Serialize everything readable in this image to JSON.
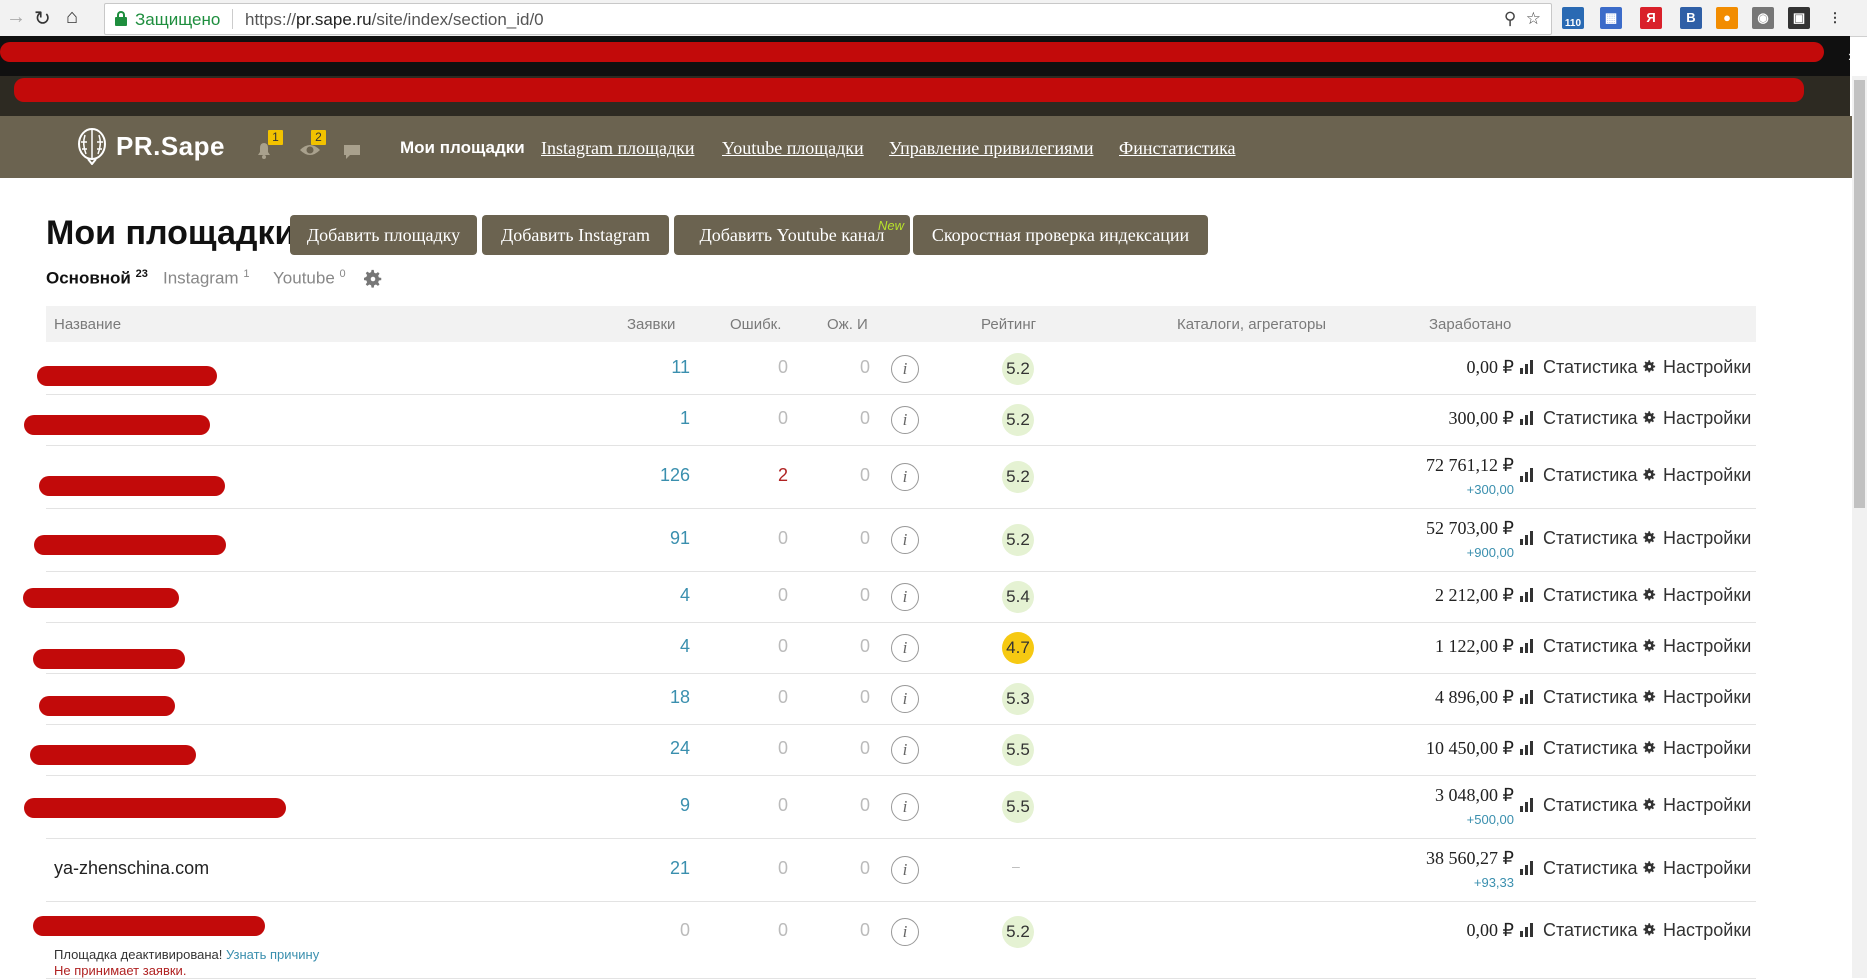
{
  "browser": {
    "secure_label": "Защищено",
    "url_prefix": "https://",
    "url_host": "pr.sape.ru",
    "url_path": "/site/index/section_id/0",
    "extension_badge": "110"
  },
  "header": {
    "logo_text": "PR.Sape",
    "notifications_count": "1",
    "watch_count": "2",
    "nav": [
      {
        "label": "Мои площадки"
      },
      {
        "label": "Instagram площадки"
      },
      {
        "label": "Youtube площадки"
      },
      {
        "label": "Управление привилегиями"
      },
      {
        "label": "Финстатистика"
      }
    ]
  },
  "page": {
    "title": "Мои площадки",
    "buttons": {
      "add_site": "Добавить площадку",
      "add_instagram": "Добавить Instagram",
      "add_youtube": "Добавить Youtube канал",
      "new_tag": "New",
      "index_check": "Скоростная проверка индексации"
    },
    "tabs": [
      {
        "label": "Основной",
        "count": "23"
      },
      {
        "label": "Instagram",
        "count": "1"
      },
      {
        "label": "Youtube",
        "count": "0"
      }
    ]
  },
  "table": {
    "headers": {
      "name": "Название",
      "requests": "Заявки",
      "errors": "Ошибк.",
      "waiting": "Ож. И",
      "rating": "Рейтинг",
      "catalogs": "Каталоги, агрегаторы",
      "earned": "Заработано"
    },
    "info_glyph": "i",
    "stat_label": "Статистика",
    "settings_label": "Настройки",
    "rows": [
      {
        "name": "",
        "requests": "11",
        "errors": "0",
        "waiting": "0",
        "rating": "5.2",
        "earned": "0,00 ₽",
        "delta": ""
      },
      {
        "name": "",
        "requests": "1",
        "errors": "0",
        "waiting": "0",
        "rating": "5.2",
        "earned": "300,00 ₽",
        "delta": ""
      },
      {
        "name": "",
        "requests": "126",
        "errors": "2",
        "waiting": "0",
        "rating": "5.2",
        "earned": "72 761,12 ₽",
        "delta": "+300,00"
      },
      {
        "name": "",
        "requests": "91",
        "errors": "0",
        "waiting": "0",
        "rating": "5.2",
        "earned": "52 703,00 ₽",
        "delta": "+900,00"
      },
      {
        "name": "",
        "requests": "4",
        "errors": "0",
        "waiting": "0",
        "rating": "5.4",
        "earned": "2 212,00 ₽",
        "delta": ""
      },
      {
        "name": "",
        "requests": "4",
        "errors": "0",
        "waiting": "0",
        "rating": "4.7",
        "earned": "1 122,00 ₽",
        "delta": ""
      },
      {
        "name": "",
        "requests": "18",
        "errors": "0",
        "waiting": "0",
        "rating": "5.3",
        "earned": "4 896,00 ₽",
        "delta": ""
      },
      {
        "name": "",
        "requests": "24",
        "errors": "0",
        "waiting": "0",
        "rating": "5.5",
        "earned": "10 450,00 ₽",
        "delta": ""
      },
      {
        "name": "",
        "requests": "9",
        "errors": "0",
        "waiting": "0",
        "rating": "5.5",
        "earned": "3 048,00 ₽",
        "delta": "+500,00"
      },
      {
        "name": "ya-zhenschina.com",
        "requests": "21",
        "errors": "0",
        "waiting": "0",
        "rating": "–",
        "earned": "38 560,27 ₽",
        "delta": "+93,33"
      },
      {
        "name": "",
        "requests": "0",
        "errors": "0",
        "waiting": "0",
        "rating": "5.2",
        "earned": "0,00 ₽",
        "delta": ""
      }
    ],
    "deactivated": {
      "text": "Площадка деактивирована!",
      "link": "Узнать причину",
      "no_requests": "Не принимает заявки."
    }
  },
  "colors": {
    "header_bg": "#6b6350",
    "accent_blue": "#3a8fae",
    "rating_green": "#e5f2d3",
    "rating_yellow": "#f6c912",
    "error_red": "#b02222"
  }
}
